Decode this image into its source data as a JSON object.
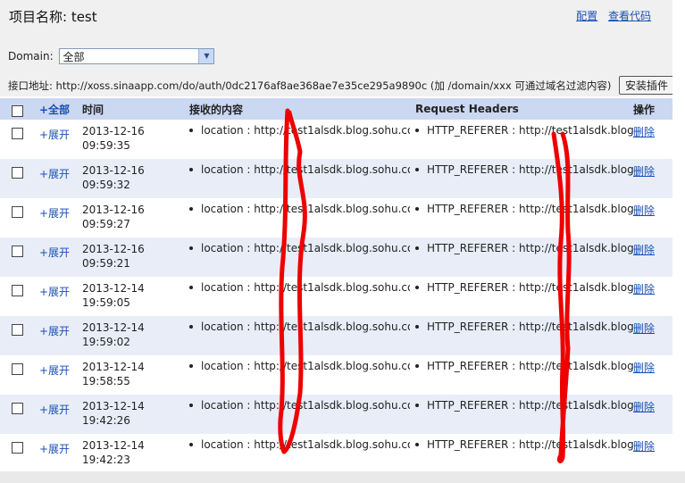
{
  "header": {
    "title": "项目名称: test",
    "links": [
      "配置",
      "查看代码"
    ]
  },
  "domain": {
    "label": "Domain:",
    "selected": "全部"
  },
  "api": {
    "text": "接口地址: http://xoss.sinaapp.com/do/auth/0dc2176af8ae368ae7e35ce295a9890c (加 /domain/xxx 可通过域名过滤内容)",
    "install_button": "安装插件"
  },
  "table": {
    "headers": {
      "expand_all": "+全部",
      "time": "时间",
      "content": "接收的内容",
      "request_headers": "Request Headers",
      "action": "操作"
    },
    "rows": [
      {
        "expand": "+展开",
        "date": "2013-12-16",
        "time": "09:59:35",
        "content": "location : http://test1alsdk.blog.sohu.co",
        "headers": "HTTP_REFERER : http://test1alsdk.blog",
        "action": "删除"
      },
      {
        "expand": "+展开",
        "date": "2013-12-16",
        "time": "09:59:32",
        "content": "location : http://test1alsdk.blog.sohu.co",
        "headers": "HTTP_REFERER : http://test1alsdk.blog",
        "action": "删除"
      },
      {
        "expand": "+展开",
        "date": "2013-12-16",
        "time": "09:59:27",
        "content": "location : http://test1alsdk.blog.sohu.co",
        "headers": "HTTP_REFERER : http://test1alsdk.blog",
        "action": "删除"
      },
      {
        "expand": "+展开",
        "date": "2013-12-16",
        "time": "09:59:21",
        "content": "location : http://test1alsdk.blog.sohu.co",
        "headers": "HTTP_REFERER : http://test1alsdk.blog",
        "action": "删除"
      },
      {
        "expand": "+展开",
        "date": "2013-12-14",
        "time": "19:59:05",
        "content": "location : http://test1alsdk.blog.sohu.co",
        "headers": "HTTP_REFERER : http://test1alsdk.blog",
        "action": "删除"
      },
      {
        "expand": "+展开",
        "date": "2013-12-14",
        "time": "19:59:02",
        "content": "location : http://test1alsdk.blog.sohu.co",
        "headers": "HTTP_REFERER : http://test1alsdk.blog",
        "action": "删除"
      },
      {
        "expand": "+展开",
        "date": "2013-12-14",
        "time": "19:58:55",
        "content": "location : http://test1alsdk.blog.sohu.co",
        "headers": "HTTP_REFERER : http://test1alsdk.blog",
        "action": "删除"
      },
      {
        "expand": "+展开",
        "date": "2013-12-14",
        "time": "19:42:26",
        "content": "location : http://test1alsdk.blog.sohu.co",
        "headers": "HTTP_REFERER : http://test1alsdk.blog",
        "action": "删除"
      },
      {
        "expand": "+展开",
        "date": "2013-12-14",
        "time": "19:42:23",
        "content": "location : http://test1alsdk.blog.sohu.co",
        "headers": "HTTP_REFERER : http://test1alsdk.blog",
        "action": "删除"
      }
    ]
  },
  "colors": {
    "header_row": "#cbd8f2",
    "alt_row": "#e8edf8",
    "link": "#1a4fb5",
    "scribble": "#ee0000"
  }
}
